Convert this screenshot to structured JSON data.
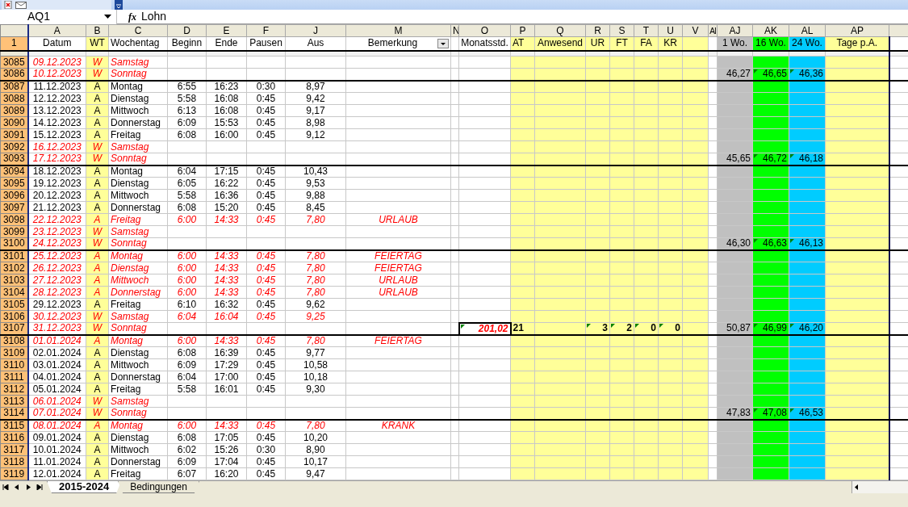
{
  "formula_bar": {
    "name_box": "AQ1",
    "function_label": "fx",
    "formula": "Lohn"
  },
  "header_row_number": "1",
  "columns": [
    {
      "letter": "A",
      "label": "Datum"
    },
    {
      "letter": "B",
      "label": "WT",
      "color": "#ffff99"
    },
    {
      "letter": "C",
      "label": "Wochentag"
    },
    {
      "letter": "D",
      "label": "Beginn"
    },
    {
      "letter": "E",
      "label": "Ende"
    },
    {
      "letter": "F",
      "label": "Pausen"
    },
    {
      "letter": "J",
      "label": "Aus"
    },
    {
      "letter": "M",
      "label": "Bemerkung",
      "filter": true
    },
    {
      "letter": "N"
    },
    {
      "letter": "O",
      "label": "Monatsstd."
    },
    {
      "letter": "P",
      "label": "AT",
      "color": "#ffff99"
    },
    {
      "letter": "Q",
      "label": "Anwesend",
      "color": "#ffff99"
    },
    {
      "letter": "R",
      "label": "UR",
      "color": "#ffff99"
    },
    {
      "letter": "S",
      "label": "FT",
      "color": "#ffff99"
    },
    {
      "letter": "T",
      "label": "FA",
      "color": "#ffff99"
    },
    {
      "letter": "U",
      "label": "KR",
      "color": "#ffff99"
    },
    {
      "letter": "V",
      "color": "#ffff99"
    },
    {
      "letter": "AI"
    },
    {
      "letter": "AJ",
      "label": "1 Wo.",
      "color": "#c0c0c0"
    },
    {
      "letter": "AK",
      "label": "16 Wo.",
      "color": "#00ff00"
    },
    {
      "letter": "AL",
      "label": "24 Wo.",
      "color": "#00ccff"
    },
    {
      "letter": "AP",
      "label": "Tage p.A.",
      "color": "#ffff99"
    }
  ],
  "rows": [
    {
      "row": "3085",
      "datum": "09.12.2023",
      "wt": "W",
      "wochentag": "Samstag",
      "red": true,
      "week_border": false
    },
    {
      "row": "3086",
      "datum": "10.12.2023",
      "wt": "W",
      "wochentag": "Sonntag",
      "red": true,
      "week_border": true,
      "wo1": {
        "text": "46,27",
        "marker": false
      },
      "wo16": {
        "text": "46,65",
        "marker": true
      },
      "wo24": {
        "text": "46,36",
        "marker": true
      }
    },
    {
      "row": "3087",
      "datum": "11.12.2023",
      "wt": "A",
      "wochentag": "Montag",
      "beginn": "6:55",
      "ende": "16:23",
      "pausen": "0:30",
      "aus": "8,97",
      "red": false,
      "week_border": false
    },
    {
      "row": "3088",
      "datum": "12.12.2023",
      "wt": "A",
      "wochentag": "Dienstag",
      "beginn": "5:58",
      "ende": "16:08",
      "pausen": "0:45",
      "aus": "9,42",
      "red": false,
      "week_border": false
    },
    {
      "row": "3089",
      "datum": "13.12.2023",
      "wt": "A",
      "wochentag": "Mittwoch",
      "beginn": "6:13",
      "ende": "16:08",
      "pausen": "0:45",
      "aus": "9,17",
      "red": false,
      "week_border": false
    },
    {
      "row": "3090",
      "datum": "14.12.2023",
      "wt": "A",
      "wochentag": "Donnerstag",
      "beginn": "6:09",
      "ende": "15:53",
      "pausen": "0:45",
      "aus": "8,98",
      "red": false,
      "week_border": false
    },
    {
      "row": "3091",
      "datum": "15.12.2023",
      "wt": "A",
      "wochentag": "Freitag",
      "beginn": "6:08",
      "ende": "16:00",
      "pausen": "0:45",
      "aus": "9,12",
      "red": false,
      "week_border": false
    },
    {
      "row": "3092",
      "datum": "16.12.2023",
      "wt": "W",
      "wochentag": "Samstag",
      "red": true,
      "week_border": false
    },
    {
      "row": "3093",
      "datum": "17.12.2023",
      "wt": "W",
      "wochentag": "Sonntag",
      "red": true,
      "week_border": true,
      "wo1": {
        "text": "45,65",
        "marker": false
      },
      "wo16": {
        "text": "46,72",
        "marker": true
      },
      "wo24": {
        "text": "46,18",
        "marker": true
      }
    },
    {
      "row": "3094",
      "datum": "18.12.2023",
      "wt": "A",
      "wochentag": "Montag",
      "beginn": "6:04",
      "ende": "17:15",
      "pausen": "0:45",
      "aus": "10,43",
      "red": false,
      "week_border": false
    },
    {
      "row": "3095",
      "datum": "19.12.2023",
      "wt": "A",
      "wochentag": "Dienstag",
      "beginn": "6:05",
      "ende": "16:22",
      "pausen": "0:45",
      "aus": "9,53",
      "red": false,
      "week_border": false
    },
    {
      "row": "3096",
      "datum": "20.12.2023",
      "wt": "A",
      "wochentag": "Mittwoch",
      "beginn": "5:58",
      "ende": "16:36",
      "pausen": "0:45",
      "aus": "9,88",
      "red": false,
      "week_border": false
    },
    {
      "row": "3097",
      "datum": "21.12.2023",
      "wt": "A",
      "wochentag": "Donnerstag",
      "beginn": "6:08",
      "ende": "15:20",
      "pausen": "0:45",
      "aus": "8,45",
      "red": false,
      "week_border": false
    },
    {
      "row": "3098",
      "datum": "22.12.2023",
      "wt": "A",
      "wochentag": "Freitag",
      "beginn": "6:00",
      "ende": "14:33",
      "pausen": "0:45",
      "aus": "7,80",
      "bemerkung": "URLAUB",
      "red": true,
      "week_border": false
    },
    {
      "row": "3099",
      "datum": "23.12.2023",
      "wt": "W",
      "wochentag": "Samstag",
      "red": true,
      "week_border": false
    },
    {
      "row": "3100",
      "datum": "24.12.2023",
      "wt": "W",
      "wochentag": "Sonntag",
      "red": true,
      "week_border": true,
      "wo1": {
        "text": "46,30",
        "marker": false
      },
      "wo16": {
        "text": "46,63",
        "marker": true
      },
      "wo24": {
        "text": "46,13",
        "marker": true
      }
    },
    {
      "row": "3101",
      "datum": "25.12.2023",
      "wt": "A",
      "wochentag": "Montag",
      "beginn": "6:00",
      "ende": "14:33",
      "pausen": "0:45",
      "aus": "7,80",
      "bemerkung": "FEIERTAG",
      "red": true,
      "week_border": false
    },
    {
      "row": "3102",
      "datum": "26.12.2023",
      "wt": "A",
      "wochentag": "Dienstag",
      "beginn": "6:00",
      "ende": "14:33",
      "pausen": "0:45",
      "aus": "7,80",
      "bemerkung": "FEIERTAG",
      "red": true,
      "week_border": false
    },
    {
      "row": "3103",
      "datum": "27.12.2023",
      "wt": "A",
      "wochentag": "Mittwoch",
      "beginn": "6:00",
      "ende": "14:33",
      "pausen": "0:45",
      "aus": "7,80",
      "bemerkung": "URLAUB",
      "red": true,
      "week_border": false
    },
    {
      "row": "3104",
      "datum": "28.12.2023",
      "wt": "A",
      "wochentag": "Donnerstag",
      "beginn": "6:00",
      "ende": "14:33",
      "pausen": "0:45",
      "aus": "7,80",
      "bemerkung": "URLAUB",
      "red": true,
      "week_border": false
    },
    {
      "row": "3105",
      "datum": "29.12.2023",
      "wt": "A",
      "wochentag": "Freitag",
      "beginn": "6:10",
      "ende": "16:32",
      "pausen": "0:45",
      "aus": "9,62",
      "red": false,
      "week_border": false
    },
    {
      "row": "3106",
      "datum": "30.12.2023",
      "wt": "W",
      "wochentag": "Samstag",
      "beginn": "6:04",
      "ende": "16:04",
      "pausen": "0:45",
      "aus": "9,25",
      "red": true,
      "week_border": false
    },
    {
      "row": "3107",
      "datum": "31.12.2023",
      "wt": "W",
      "wochentag": "Sonntag",
      "red": true,
      "week_border": true,
      "monatsstd": {
        "text": "201,02",
        "marker": true
      },
      "at": {
        "text": "21",
        "marker": false
      },
      "ur": {
        "text": "3",
        "marker": true
      },
      "ft": {
        "text": "2",
        "marker": true
      },
      "fa": {
        "text": "0",
        "marker": true
      },
      "kr": {
        "text": "0",
        "marker": true
      },
      "wo1": {
        "text": "50,87",
        "marker": false
      },
      "wo16": {
        "text": "46,99",
        "marker": true
      },
      "wo24": {
        "text": "46,20",
        "marker": true
      }
    },
    {
      "row": "3108",
      "datum": "01.01.2024",
      "wt": "A",
      "wochentag": "Montag",
      "beginn": "6:00",
      "ende": "14:33",
      "pausen": "0:45",
      "aus": "7,80",
      "bemerkung": "FEIERTAG",
      "red": true,
      "week_border": false
    },
    {
      "row": "3109",
      "datum": "02.01.2024",
      "wt": "A",
      "wochentag": "Dienstag",
      "beginn": "6:08",
      "ende": "16:39",
      "pausen": "0:45",
      "aus": "9,77",
      "red": false,
      "week_border": false
    },
    {
      "row": "3110",
      "datum": "03.01.2024",
      "wt": "A",
      "wochentag": "Mittwoch",
      "beginn": "6:09",
      "ende": "17:29",
      "pausen": "0:45",
      "aus": "10,58",
      "red": false,
      "week_border": false
    },
    {
      "row": "3111",
      "datum": "04.01.2024",
      "wt": "A",
      "wochentag": "Donnerstag",
      "beginn": "6:04",
      "ende": "17:00",
      "pausen": "0:45",
      "aus": "10,18",
      "red": false,
      "week_border": false
    },
    {
      "row": "3112",
      "datum": "05.01.2024",
      "wt": "A",
      "wochentag": "Freitag",
      "beginn": "5:58",
      "ende": "16:01",
      "pausen": "0:45",
      "aus": "9,30",
      "red": false,
      "week_border": false
    },
    {
      "row": "3113",
      "datum": "06.01.2024",
      "wt": "W",
      "wochentag": "Samstag",
      "red": true,
      "week_border": false
    },
    {
      "row": "3114",
      "datum": "07.01.2024",
      "wt": "W",
      "wochentag": "Sonntag",
      "red": true,
      "week_border": true,
      "wo1": {
        "text": "47,83",
        "marker": false
      },
      "wo16": {
        "text": "47,08",
        "marker": true
      },
      "wo24": {
        "text": "46,53",
        "marker": true
      }
    },
    {
      "row": "3115",
      "datum": "08.01.2024",
      "wt": "A",
      "wochentag": "Montag",
      "beginn": "6:00",
      "ende": "14:33",
      "pausen": "0:45",
      "aus": "7,80",
      "bemerkung": "KRANK",
      "red": true,
      "week_border": false
    },
    {
      "row": "3116",
      "datum": "09.01.2024",
      "wt": "A",
      "wochentag": "Dienstag",
      "beginn": "6:08",
      "ende": "17:05",
      "pausen": "0:45",
      "aus": "10,20",
      "red": false,
      "week_border": false
    },
    {
      "row": "3117",
      "datum": "10.01.2024",
      "wt": "A",
      "wochentag": "Mittwoch",
      "beginn": "6:02",
      "ende": "15:26",
      "pausen": "0:30",
      "aus": "8,90",
      "red": false,
      "week_border": false
    },
    {
      "row": "3118",
      "datum": "11.01.2024",
      "wt": "A",
      "wochentag": "Donnerstag",
      "beginn": "6:09",
      "ende": "17:04",
      "pausen": "0:45",
      "aus": "10,17",
      "red": false,
      "week_border": false
    },
    {
      "row": "3119",
      "datum": "12.01.2024",
      "wt": "A",
      "wochentag": "Freitag",
      "beginn": "6:07",
      "ende": "16:20",
      "pausen": "0:45",
      "aus": "9,47",
      "red": false,
      "week_border": false
    }
  ],
  "sheet_tabs": [
    {
      "label": "2015-2024",
      "selected": true
    },
    {
      "label": "Bedingungen",
      "selected": false
    }
  ]
}
